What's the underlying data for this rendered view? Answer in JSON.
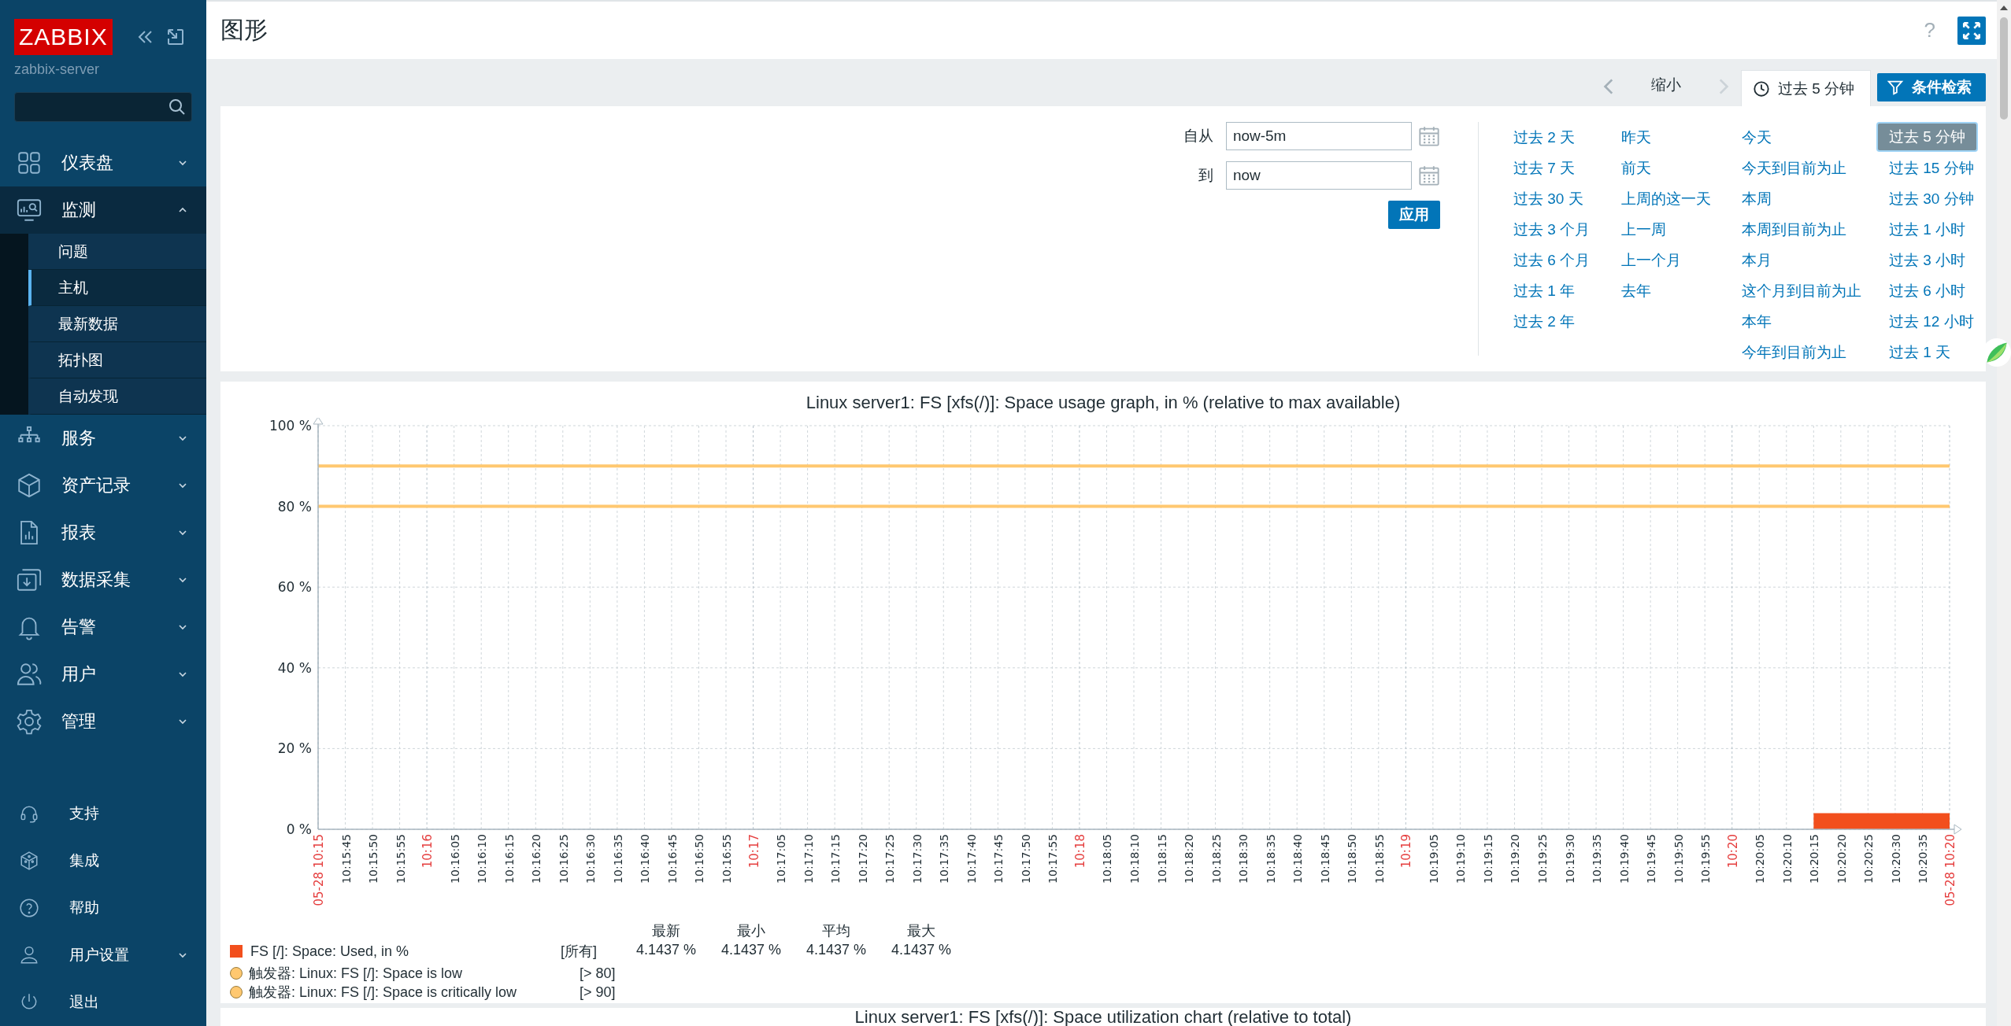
{
  "sidebar": {
    "logo": "ZABBIX",
    "server": "zabbix-server",
    "menu": [
      {
        "label": "仪表盘",
        "expanded": false
      },
      {
        "label": "监测",
        "expanded": true,
        "children": [
          {
            "label": "问题",
            "selected": false
          },
          {
            "label": "主机",
            "selected": true
          },
          {
            "label": "最新数据",
            "selected": false
          },
          {
            "label": "拓扑图",
            "selected": false
          },
          {
            "label": "自动发现",
            "selected": false
          }
        ]
      },
      {
        "label": "服务",
        "expanded": false
      },
      {
        "label": "资产记录",
        "expanded": false
      },
      {
        "label": "报表",
        "expanded": false
      },
      {
        "label": "数据采集",
        "expanded": false
      },
      {
        "label": "告警",
        "expanded": false
      },
      {
        "label": "用户",
        "expanded": false
      },
      {
        "label": "管理",
        "expanded": false
      }
    ],
    "footer_menu": [
      {
        "label": "支持",
        "kind": "link"
      },
      {
        "label": "集成",
        "kind": "link"
      },
      {
        "label": "帮助",
        "kind": "link"
      },
      {
        "label": "用户设置",
        "kind": "menu",
        "expanded": false
      },
      {
        "label": "退出",
        "kind": "link"
      }
    ]
  },
  "header": {
    "title": "图形",
    "help": "?"
  },
  "time_bar": {
    "zoom_out": "缩小",
    "range_tab": {
      "label": "过去 5 分钟",
      "selected": true
    },
    "filter_button": "条件检索"
  },
  "time_filter": {
    "from_label": "自从",
    "from": "now-5m",
    "to_label": "到",
    "to": "now",
    "apply": "应用",
    "quick_ranges": [
      [
        {
          "label": "过去 2 天",
          "selected": false
        },
        {
          "label": "过去 7 天",
          "selected": false
        },
        {
          "label": "过去 30 天",
          "selected": false
        },
        {
          "label": "过去 3 个月",
          "selected": false
        },
        {
          "label": "过去 6 个月",
          "selected": false
        },
        {
          "label": "过去 1 年",
          "selected": false
        },
        {
          "label": "过去 2 年",
          "selected": false
        }
      ],
      [
        {
          "label": "昨天",
          "selected": false
        },
        {
          "label": "前天",
          "selected": false
        },
        {
          "label": "上周的这一天",
          "selected": false
        },
        {
          "label": "上一周",
          "selected": false
        },
        {
          "label": "上一个月",
          "selected": false
        },
        {
          "label": "去年",
          "selected": false
        }
      ],
      [
        {
          "label": "今天",
          "selected": false
        },
        {
          "label": "今天到目前为止",
          "selected": false
        },
        {
          "label": "本周",
          "selected": false
        },
        {
          "label": "本周到目前为止",
          "selected": false
        },
        {
          "label": "本月",
          "selected": false
        },
        {
          "label": "这个月到目前为止",
          "selected": false
        },
        {
          "label": "本年",
          "selected": false
        },
        {
          "label": "今年到目前为止",
          "selected": false
        }
      ],
      [
        {
          "label": "过去 5 分钟",
          "selected": true
        },
        {
          "label": "过去 15 分钟",
          "selected": false
        },
        {
          "label": "过去 30 分钟",
          "selected": false
        },
        {
          "label": "过去 1 小时",
          "selected": false
        },
        {
          "label": "过去 3 小时",
          "selected": false
        },
        {
          "label": "过去 6 小时",
          "selected": false
        },
        {
          "label": "过去 12 小时",
          "selected": false
        },
        {
          "label": "过去 1 天",
          "selected": false
        }
      ]
    ]
  },
  "graphs": [
    {
      "title": "Linux server1: FS [xfs(/)]: Space usage graph, in % (relative to max available)",
      "chart_data": {
        "type": "area",
        "ylim": [
          0,
          100
        ],
        "yticks": [
          {
            "value": 0,
            "label": "0 %"
          },
          {
            "value": 20,
            "label": "20 %"
          },
          {
            "value": 40,
            "label": "40 %"
          },
          {
            "value": 60,
            "label": "60 %"
          },
          {
            "value": 80,
            "label": "80 %"
          },
          {
            "value": 100,
            "label": "100 %"
          }
        ],
        "categories": [
          "05-28 10:15",
          "10:15:45",
          "10:15:50",
          "10:15:55",
          "10:16",
          "10:16:05",
          "10:16:10",
          "10:16:15",
          "10:16:20",
          "10:16:25",
          "10:16:30",
          "10:16:35",
          "10:16:40",
          "10:16:45",
          "10:16:50",
          "10:16:55",
          "10:17",
          "10:17:05",
          "10:17:10",
          "10:17:15",
          "10:17:20",
          "10:17:25",
          "10:17:30",
          "10:17:35",
          "10:17:40",
          "10:17:45",
          "10:17:50",
          "10:17:55",
          "10:18",
          "10:18:05",
          "10:18:10",
          "10:18:15",
          "10:18:20",
          "10:18:25",
          "10:18:30",
          "10:18:35",
          "10:18:40",
          "10:18:45",
          "10:18:50",
          "10:18:55",
          "10:19",
          "10:19:05",
          "10:19:10",
          "10:19:15",
          "10:19:20",
          "10:19:25",
          "10:19:30",
          "10:19:35",
          "10:19:40",
          "10:19:45",
          "10:19:50",
          "10:19:55",
          "10:20",
          "10:20:05",
          "10:20:10",
          "10:20:15",
          "10:20:20",
          "10:20:25",
          "10:20:30",
          "10:20:35",
          "05-28 10:20"
        ],
        "series": [
          {
            "name": "FS [/]: Space: Used, in %",
            "color": "#f24f1d",
            "values": [
              null,
              null,
              null,
              null,
              null,
              null,
              null,
              null,
              null,
              null,
              null,
              null,
              null,
              null,
              null,
              null,
              null,
              null,
              null,
              null,
              null,
              null,
              null,
              null,
              null,
              null,
              null,
              null,
              null,
              null,
              null,
              null,
              null,
              null,
              null,
              null,
              null,
              null,
              null,
              null,
              null,
              null,
              null,
              null,
              null,
              null,
              null,
              null,
              null,
              null,
              null,
              null,
              null,
              null,
              null,
              4,
              4,
              4,
              4,
              4,
              4
            ]
          }
        ],
        "grid": true,
        "ref_lines": [
          {
            "axis": "y",
            "value": 90,
            "color": "#ffc870"
          },
          {
            "axis": "y",
            "value": 80,
            "color": "#ffc870"
          }
        ]
      },
      "x_label_major": [
        true,
        false,
        false,
        false,
        true,
        false,
        false,
        false,
        false,
        false,
        false,
        false,
        false,
        false,
        false,
        false,
        true,
        false,
        false,
        false,
        false,
        false,
        false,
        false,
        false,
        false,
        false,
        false,
        true,
        false,
        false,
        false,
        false,
        false,
        false,
        false,
        false,
        false,
        false,
        false,
        true,
        false,
        false,
        false,
        false,
        false,
        false,
        false,
        false,
        false,
        false,
        false,
        true,
        false,
        false,
        false,
        false,
        false,
        false,
        false,
        true
      ],
      "legend": {
        "columns": [
          "最新",
          "最小",
          "平均",
          "最大"
        ],
        "items": [
          {
            "function": "[所有]",
            "values": [
              "4.1437 %",
              "4.1437 %",
              "4.1437 %",
              "4.1437 %"
            ]
          }
        ],
        "triggers": [
          {
            "color": "#ffc870",
            "label": "触发器: Linux: FS [/]: Space is low",
            "condition": "[> 80]"
          },
          {
            "color": "#ffc870",
            "label": "触发器: Linux: FS [/]: Space is critically low",
            "condition": "[> 90]"
          }
        ]
      }
    },
    {
      "title": "Linux server1: FS [xfs(/)]: Space utilization chart (relative to total)"
    }
  ]
}
